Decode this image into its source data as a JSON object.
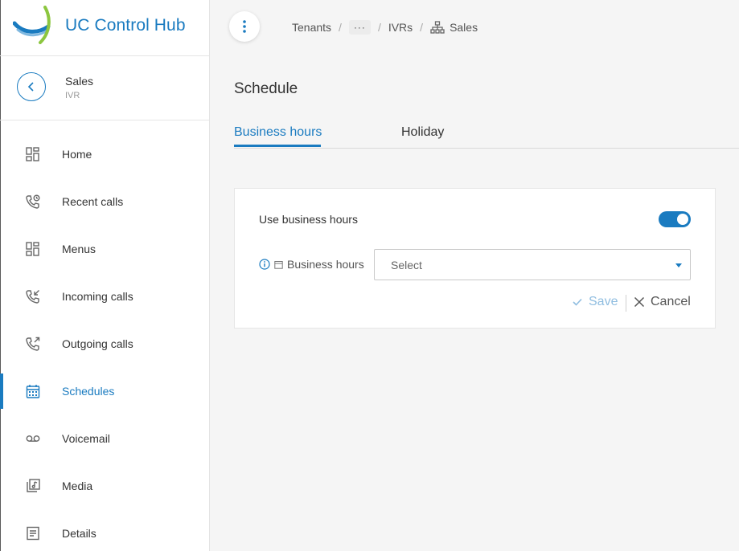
{
  "app": {
    "name": "UC Control Hub",
    "accent_color": "#1a7bc0"
  },
  "context": {
    "title": "Sales",
    "subtitle": "IVR"
  },
  "sidebar": {
    "items": [
      {
        "label": "Home",
        "icon": "dashboard-icon",
        "active": false
      },
      {
        "label": "Recent calls",
        "icon": "phone-clock-icon",
        "active": false
      },
      {
        "label": "Menus",
        "icon": "dashboard-icon",
        "active": false
      },
      {
        "label": "Incoming calls",
        "icon": "phone-incoming-icon",
        "active": false
      },
      {
        "label": "Outgoing calls",
        "icon": "phone-outgoing-icon",
        "active": false
      },
      {
        "label": "Schedules",
        "icon": "calendar-icon",
        "active": true
      },
      {
        "label": "Voicemail",
        "icon": "voicemail-icon",
        "active": false
      },
      {
        "label": "Media",
        "icon": "media-library-icon",
        "active": false
      },
      {
        "label": "Details",
        "icon": "document-icon",
        "active": false
      }
    ]
  },
  "breadcrumb": {
    "tenants": "Tenants",
    "ellipsis": "···",
    "ivrs": "IVRs",
    "current": "Sales"
  },
  "page": {
    "title": "Schedule"
  },
  "tabs": [
    {
      "label": "Business hours",
      "active": true
    },
    {
      "label": "Holiday",
      "active": false
    }
  ],
  "form": {
    "use_business_hours_label": "Use business hours",
    "use_business_hours_enabled": true,
    "business_hours_label": "Business hours",
    "business_hours_value": "Select",
    "save_label": "Save",
    "cancel_label": "Cancel"
  }
}
